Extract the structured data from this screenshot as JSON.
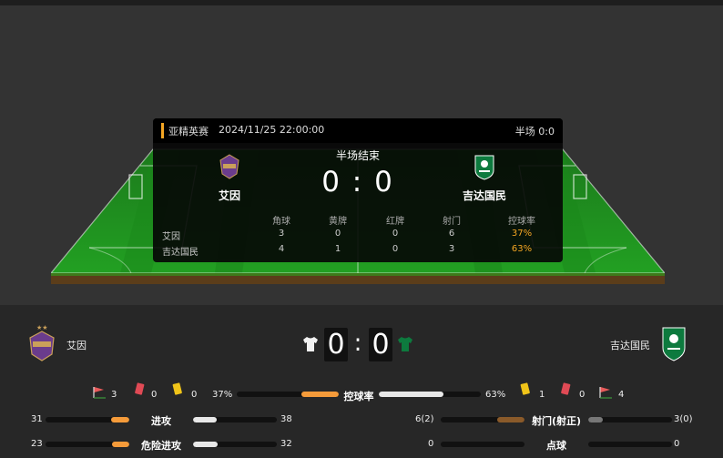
{
  "match": {
    "competition": "亚精英赛",
    "datetime": "2024/11/25 22:00:00",
    "halftime": "半场 0:0",
    "status": "半场结束",
    "score_line": "0 : 0",
    "home_score": "0",
    "away_score": "0",
    "colon": ":"
  },
  "home": {
    "name": "艾因"
  },
  "away": {
    "name": "吉达国民"
  },
  "stats_table": {
    "headers": [
      "角球",
      "黄牌",
      "红牌",
      "射门",
      "控球率"
    ],
    "rows": [
      {
        "team": "艾因",
        "values": [
          "3",
          "0",
          "0",
          "6",
          "37%"
        ]
      },
      {
        "team": "吉达国民",
        "values": [
          "4",
          "1",
          "0",
          "3",
          "63%"
        ]
      }
    ]
  },
  "summary": {
    "home_corners": "3",
    "home_red": "0",
    "home_yellow": "0",
    "away_yellow": "1",
    "away_red": "0",
    "away_corners": "4",
    "possession_label": "控球率",
    "home_possession": "37%",
    "away_possession": "63%",
    "home_possession_value": 0.37,
    "away_possession_value": 0.63
  },
  "attack_stats": [
    {
      "label": "进攻",
      "home": "31",
      "away": "38",
      "home_value": 31,
      "away_value": 38
    },
    {
      "label": "危险进攻",
      "home": "23",
      "away": "32",
      "home_value": 23,
      "away_value": 32
    }
  ],
  "shot_stats": [
    {
      "label": "射门(射正)",
      "home": "6(2)",
      "away": "3(0)",
      "home_value": 6,
      "away_value": 3
    },
    {
      "label": "点球",
      "home": "0",
      "away": "0",
      "home_value": 0,
      "away_value": 0
    }
  ],
  "colors": {
    "accent": "#f5a623",
    "pitch_green": "#1f8f1f",
    "home_kit": "#ffffff",
    "away_kit": "#0d7a3e"
  },
  "icons": {
    "corner": "corner-flag-icon",
    "red_card": "red-card-icon",
    "yellow_card": "yellow-card-icon"
  }
}
